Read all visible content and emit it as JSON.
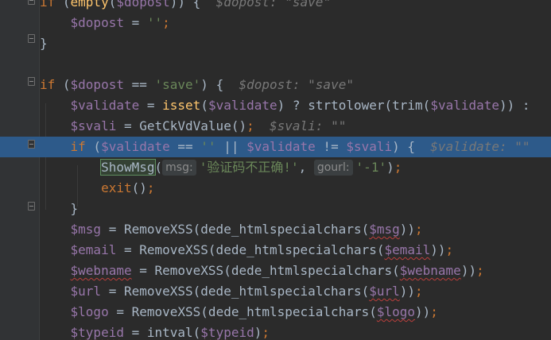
{
  "editor": {
    "lines": [
      {
        "tokens": [
          {
            "t": "kw",
            "v": "if"
          },
          {
            "t": "pun",
            "v": " ("
          },
          {
            "t": "fn",
            "v": "empty"
          },
          {
            "t": "pun",
            "v": "("
          },
          {
            "t": "var",
            "v": "$dopost"
          },
          {
            "t": "pun",
            "v": ")) {  "
          },
          {
            "t": "hint",
            "v": "$dopost: \"save\""
          }
        ]
      },
      {
        "tokens": [
          {
            "t": "pun",
            "v": "    "
          },
          {
            "t": "var",
            "v": "$dopost"
          },
          {
            "t": "pun",
            "v": " = "
          },
          {
            "t": "str",
            "v": "''"
          },
          {
            "t": "kw",
            "v": ";"
          }
        ]
      },
      {
        "tokens": [
          {
            "t": "pun",
            "v": "}"
          }
        ]
      },
      {
        "tokens": []
      },
      {
        "tokens": [
          {
            "t": "kw",
            "v": "if"
          },
          {
            "t": "pun",
            "v": " ("
          },
          {
            "t": "var",
            "v": "$dopost"
          },
          {
            "t": "pun",
            "v": " == "
          },
          {
            "t": "str",
            "v": "'save'"
          },
          {
            "t": "pun",
            "v": ") {  "
          },
          {
            "t": "hint",
            "v": "$dopost: \"save\""
          }
        ]
      },
      {
        "tokens": [
          {
            "t": "pun",
            "v": "    "
          },
          {
            "t": "var",
            "v": "$validate"
          },
          {
            "t": "pun",
            "v": " = "
          },
          {
            "t": "fn",
            "v": "isset"
          },
          {
            "t": "pun",
            "v": "("
          },
          {
            "t": "var",
            "v": "$validate"
          },
          {
            "t": "pun",
            "v": ") ? strtolower(trim("
          },
          {
            "t": "var",
            "v": "$validate"
          },
          {
            "t": "pun",
            "v": ")) :"
          }
        ]
      },
      {
        "tokens": [
          {
            "t": "pun",
            "v": "    "
          },
          {
            "t": "var",
            "v": "$svali"
          },
          {
            "t": "pun",
            "v": " = GetCkVdValue()"
          },
          {
            "t": "kw",
            "v": ";"
          },
          {
            "t": "pun",
            "v": "  "
          },
          {
            "t": "hint",
            "v": "$svali: \"\""
          }
        ]
      },
      {
        "highlight": true,
        "tokens": [
          {
            "t": "pun",
            "v": "    "
          },
          {
            "t": "kw",
            "v": "if"
          },
          {
            "t": "pun",
            "v": " ("
          },
          {
            "t": "var",
            "v": "$validate"
          },
          {
            "t": "pun",
            "v": " == "
          },
          {
            "t": "str",
            "v": "''"
          },
          {
            "t": "pun",
            "v": " || "
          },
          {
            "t": "var",
            "v": "$validate"
          },
          {
            "t": "pun",
            "v": " != "
          },
          {
            "t": "var",
            "v": "$svali"
          },
          {
            "t": "pun",
            "v": ") {  "
          },
          {
            "t": "hint",
            "v": "$validate: \"\""
          }
        ]
      },
      {
        "tokens": [
          {
            "t": "pun",
            "v": "        "
          },
          {
            "t": "showmsg",
            "v": "ShowMsg"
          },
          {
            "t": "pun",
            "v": "("
          },
          {
            "t": "param",
            "v": "msg:"
          },
          {
            "t": "str",
            "v": "'验证码不正确!'"
          },
          {
            "t": "pun",
            "v": ", "
          },
          {
            "t": "param",
            "v": "gourl:"
          },
          {
            "t": "str",
            "v": "'-1'"
          },
          {
            "t": "pun",
            "v": ")"
          },
          {
            "t": "kw",
            "v": ";"
          }
        ]
      },
      {
        "tokens": [
          {
            "t": "pun",
            "v": "        "
          },
          {
            "t": "kw",
            "v": "exit"
          },
          {
            "t": "pun",
            "v": "()"
          },
          {
            "t": "kw",
            "v": ";"
          }
        ]
      },
      {
        "tokens": [
          {
            "t": "pun",
            "v": "    }"
          }
        ]
      },
      {
        "tokens": [
          {
            "t": "pun",
            "v": "    "
          },
          {
            "t": "var",
            "v": "$msg"
          },
          {
            "t": "pun",
            "v": " = RemoveXSS(dede_htmlspecialchars("
          },
          {
            "t": "varsq",
            "v": "$msg"
          },
          {
            "t": "pun",
            "v": "))"
          },
          {
            "t": "kw",
            "v": ";"
          }
        ]
      },
      {
        "tokens": [
          {
            "t": "pun",
            "v": "    "
          },
          {
            "t": "var",
            "v": "$email"
          },
          {
            "t": "pun",
            "v": " = RemoveXSS(dede_htmlspecialchars("
          },
          {
            "t": "varsq",
            "v": "$email"
          },
          {
            "t": "pun",
            "v": "))"
          },
          {
            "t": "kw",
            "v": ";"
          }
        ]
      },
      {
        "tokens": [
          {
            "t": "pun",
            "v": "    "
          },
          {
            "t": "varsq",
            "v": "$webname"
          },
          {
            "t": "pun",
            "v": " = RemoveXSS(dede_htmlspecialchars("
          },
          {
            "t": "varsq",
            "v": "$webname"
          },
          {
            "t": "pun",
            "v": "))"
          },
          {
            "t": "kw",
            "v": ";"
          }
        ]
      },
      {
        "tokens": [
          {
            "t": "pun",
            "v": "    "
          },
          {
            "t": "var",
            "v": "$url"
          },
          {
            "t": "pun",
            "v": " = RemoveXSS(dede_htmlspecialchars("
          },
          {
            "t": "varsq",
            "v": "$url"
          },
          {
            "t": "pun",
            "v": "))"
          },
          {
            "t": "kw",
            "v": ";"
          }
        ]
      },
      {
        "tokens": [
          {
            "t": "pun",
            "v": "    "
          },
          {
            "t": "var",
            "v": "$logo"
          },
          {
            "t": "pun",
            "v": " = RemoveXSS(dede_htmlspecialchars("
          },
          {
            "t": "varsq",
            "v": "$logo"
          },
          {
            "t": "pun",
            "v": "))"
          },
          {
            "t": "kw",
            "v": ";"
          }
        ]
      },
      {
        "tokens": [
          {
            "t": "pun",
            "v": "    "
          },
          {
            "t": "varsq",
            "v": "$typeid"
          },
          {
            "t": "pun",
            "v": " = intval("
          },
          {
            "t": "varsq",
            "v": "$typeid"
          },
          {
            "t": "pun",
            "v": ")"
          },
          {
            "t": "kw",
            "v": ";"
          }
        ]
      }
    ]
  }
}
